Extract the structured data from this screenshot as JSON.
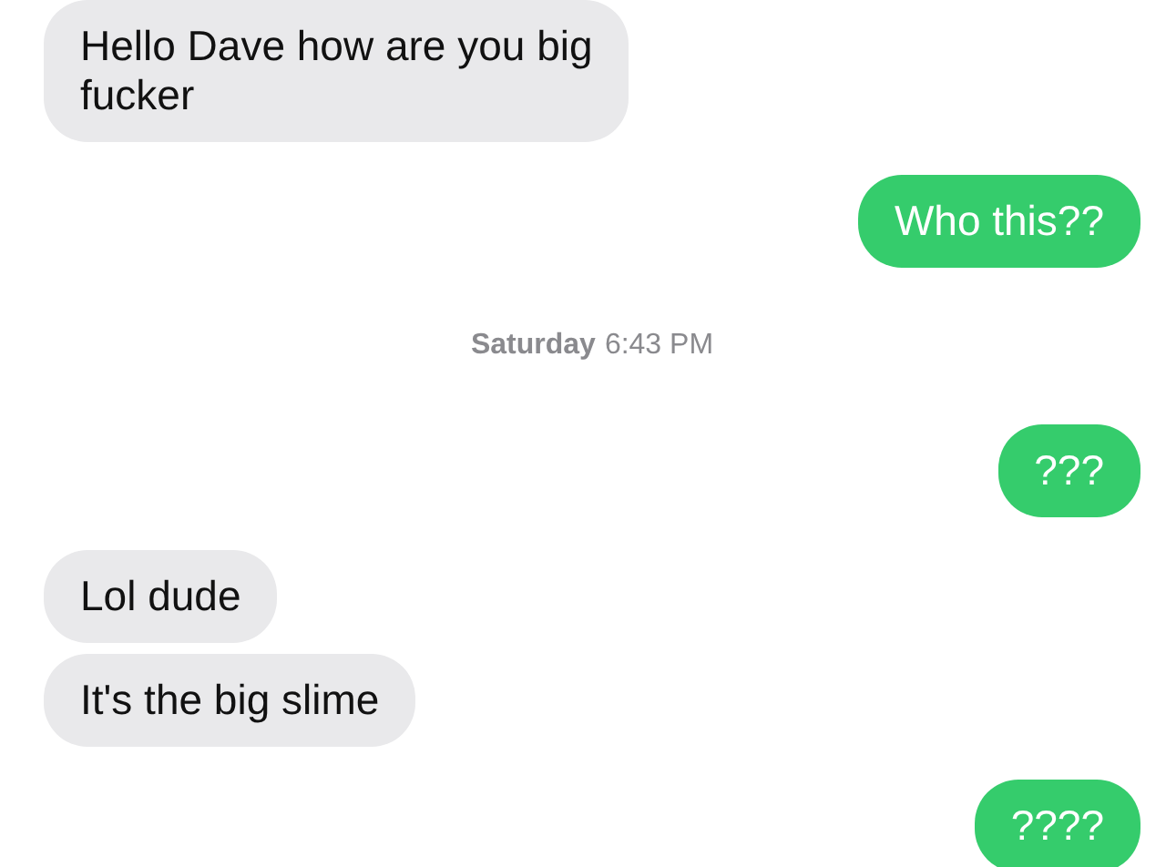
{
  "messages": [
    {
      "kind": "incoming",
      "lines": [
        "Hello Dave how are you big",
        "fucker"
      ]
    },
    {
      "kind": "outgoing",
      "lines": [
        "Who this??"
      ]
    },
    {
      "kind": "timestamp",
      "day": "Saturday",
      "time": "6:43 PM"
    },
    {
      "kind": "outgoing",
      "lines": [
        "???"
      ]
    },
    {
      "kind": "incoming",
      "lines": [
        "Lol dude"
      ]
    },
    {
      "kind": "incoming",
      "lines": [
        "It's the big slime"
      ]
    },
    {
      "kind": "outgoing",
      "lines": [
        "????"
      ]
    }
  ]
}
